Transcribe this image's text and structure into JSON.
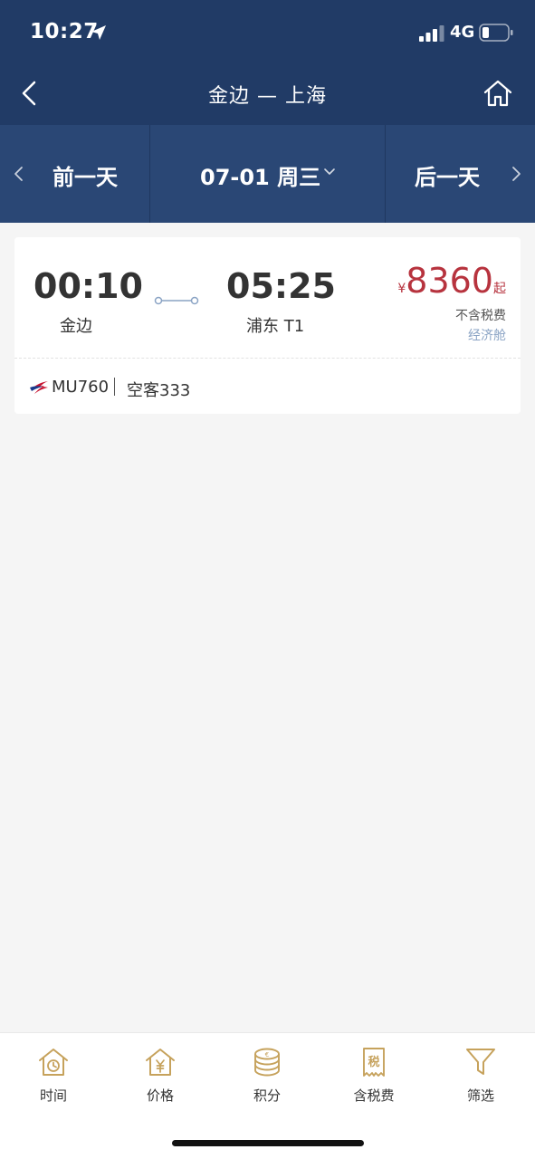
{
  "status_bar": {
    "time": "10:27",
    "network": "4G",
    "icons": [
      "location-arrow-icon",
      "signal-icon",
      "battery-icon"
    ]
  },
  "nav": {
    "title": "金边 — 上海",
    "icons": [
      "back-chevron-icon",
      "home-icon"
    ]
  },
  "date_bar": {
    "prev_label": "前一天",
    "current_label": "07-01 周三",
    "next_label": "后一天"
  },
  "flight": {
    "departure_time": "00:10",
    "departure_airport": "金边",
    "arrival_time": "05:25",
    "arrival_airport": "浦东 T1",
    "price_currency": "¥",
    "price": "8360",
    "price_suffix": "起",
    "tax_note": "不含税费",
    "cabin": "经济舱",
    "flight_number": "MU760",
    "aircraft": "空客333"
  },
  "tabbar": {
    "items": [
      {
        "label": "时间",
        "icon": "clock-house-icon"
      },
      {
        "label": "价格",
        "icon": "yen-house-icon"
      },
      {
        "label": "积分",
        "icon": "coin-stack-icon"
      },
      {
        "label": "含税费",
        "icon": "tax-receipt-icon"
      },
      {
        "label": "筛选",
        "icon": "filter-funnel-icon"
      }
    ]
  },
  "colors": {
    "header_bg": "#213b66",
    "datebar_bg": "#2a4775",
    "price": "#b7333e",
    "cabin": "#8aa3c4",
    "tab_icon": "#c6a25c"
  }
}
